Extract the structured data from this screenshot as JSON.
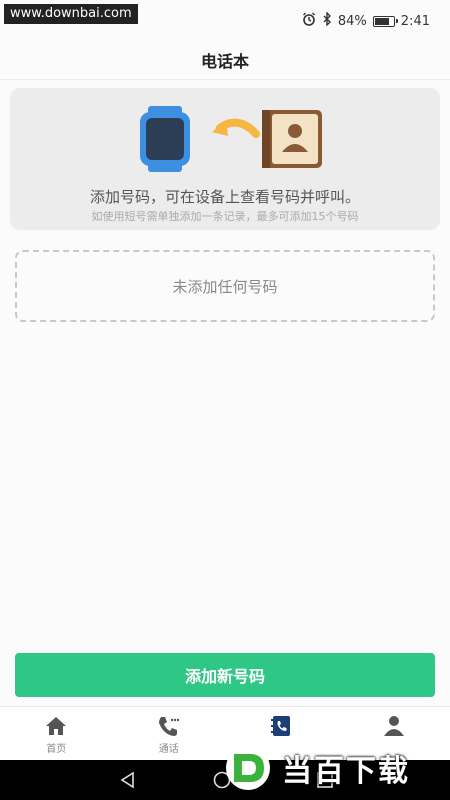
{
  "watermark_top": "www.downbai.com",
  "status": {
    "battery_text": "84%",
    "battery_level": 0.84,
    "time": "2:41"
  },
  "header": {
    "title": "电话本"
  },
  "info_card": {
    "main_text": "添加号码，可在设备上查看号码并呼叫。",
    "sub_text": "如使用短号需单独添加一条记录，最多可添加15个号码"
  },
  "empty_state": {
    "text": "未添加任何号码"
  },
  "add_button_label": "添加新号码",
  "tabs": [
    {
      "label": "首页",
      "icon": "home-icon"
    },
    {
      "label": "通话",
      "icon": "phone-icon"
    },
    {
      "label": "",
      "icon": "phonebook-icon",
      "active": true
    },
    {
      "label": "",
      "icon": "user-icon"
    }
  ],
  "watermark_logo_text": "当百下载",
  "colors": {
    "accent": "#2fc785",
    "active_tab": "#1c3f7a",
    "watch_blue": "#3d8fe0",
    "arrow_orange": "#f5b642",
    "book_brown": "#8a5a36"
  }
}
